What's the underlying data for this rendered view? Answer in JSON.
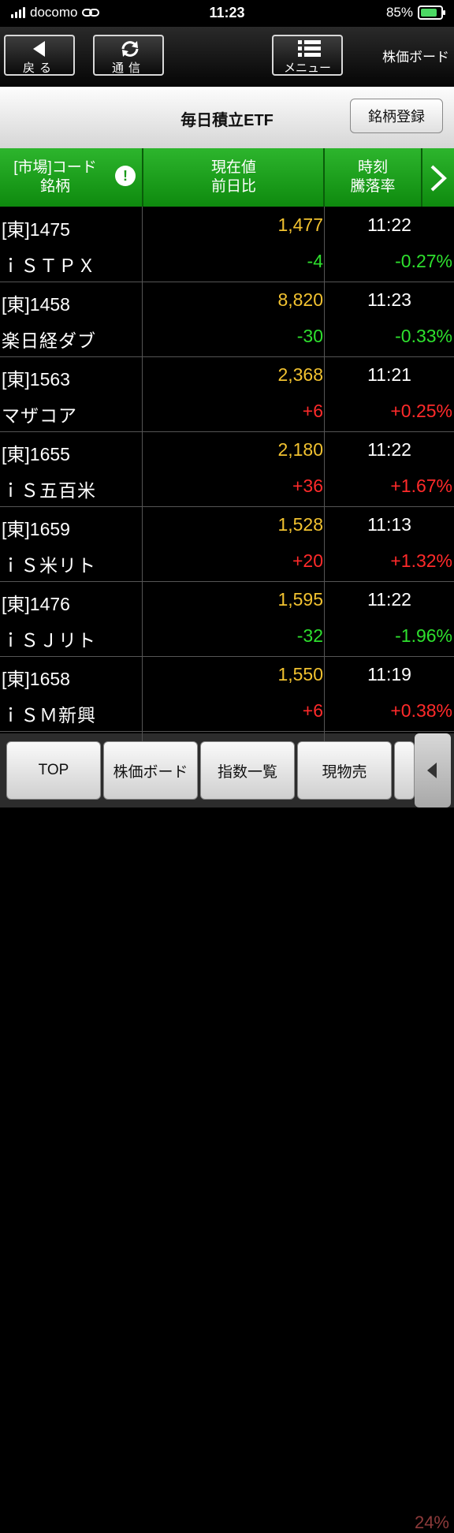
{
  "status": {
    "carrier": "docomo",
    "time": "11:23",
    "battery": "85%"
  },
  "toolbar": {
    "back_label": "戻る",
    "comm_label": "通信",
    "menu_label": "メニュー",
    "board_title": "株価ボード",
    "back_icon": "left-triangle-icon",
    "comm_icon": "refresh-icon",
    "menu_icon": "menu-list-icon"
  },
  "titlebar": {
    "title": "毎日積立ETF",
    "register_label": "銘柄登録"
  },
  "header": {
    "col1_line1": "[市場]コード",
    "col1_line2": "銘柄",
    "col2_line1": "現在値",
    "col2_line2": "前日比",
    "col3_line1": "時刻",
    "col3_line2": "騰落率",
    "info_mark": "!"
  },
  "colors": {
    "price": "#f2c230",
    "up": "#ff2a2a",
    "down": "#2ee02e",
    "header": "#1a9a1a"
  },
  "rows": [
    {
      "code": "[東]1475",
      "name": "ｉＳＴＰＸ",
      "price": "1,477",
      "change": "-4",
      "time": "11:22",
      "pct": "-0.27%",
      "dir": "down"
    },
    {
      "code": "[東]1458",
      "name": "楽日経ダブ",
      "price": "8,820",
      "change": "-30",
      "time": "11:23",
      "pct": "-0.33%",
      "dir": "down"
    },
    {
      "code": "[東]1563",
      "name": "マザコア",
      "price": "2,368",
      "change": "+6",
      "time": "11:21",
      "pct": "+0.25%",
      "dir": "up"
    },
    {
      "code": "[東]1655",
      "name": "ｉＳ五百米",
      "price": "2,180",
      "change": "+36",
      "time": "11:22",
      "pct": "+1.67%",
      "dir": "up"
    },
    {
      "code": "[東]1659",
      "name": "ｉＳ米リト",
      "price": "1,528",
      "change": "+20",
      "time": "11:13",
      "pct": "+1.32%",
      "dir": "up"
    },
    {
      "code": "[東]1476",
      "name": "ｉＳＪリト",
      "price": "1,595",
      "change": "-32",
      "time": "11:22",
      "pct": "-1.96%",
      "dir": "down"
    },
    {
      "code": "[東]1658",
      "name": "ｉＳＭ新興",
      "price": "1,550",
      "change": "+6",
      "time": "11:19",
      "pct": "+0.38%",
      "dir": "up"
    }
  ],
  "bottom": {
    "top_label": "TOP",
    "board_label": "株価ボード",
    "index_label": "指数一覧",
    "spot_label": "現物売",
    "ghost_pct": "24%"
  }
}
